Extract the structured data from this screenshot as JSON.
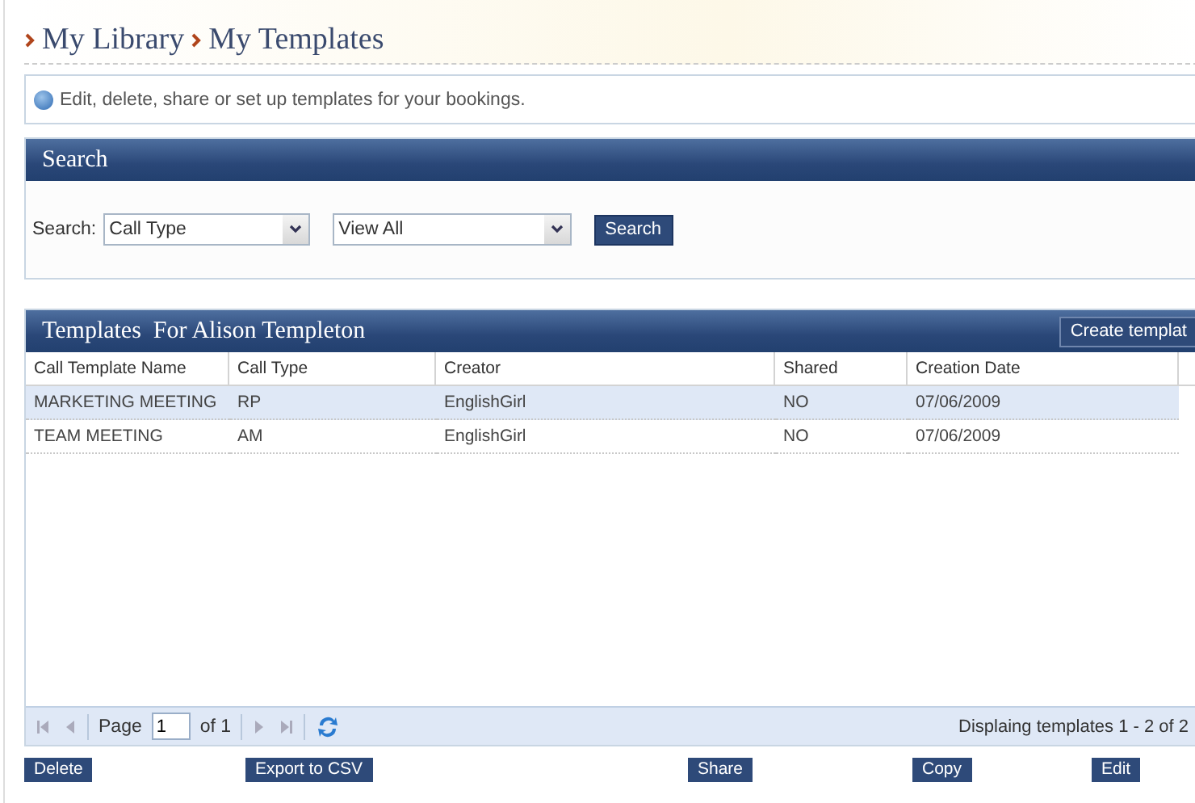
{
  "breadcrumb": [
    {
      "label": "My Library"
    },
    {
      "label": "My Templates"
    }
  ],
  "info": "Edit, delete, share or set up templates for your bookings.",
  "search": {
    "title": "Search",
    "label": "Search:",
    "field": "Call Type",
    "filter": "View All",
    "button": "Search"
  },
  "templates": {
    "title": "Templates  For Alison Templeton",
    "create_button": "Create templat",
    "columns": [
      "Call Template Name",
      "Call Type",
      "Creator",
      "Shared",
      "Creation Date"
    ],
    "rows": [
      {
        "cells": [
          "MARKETING MEETING",
          "RP",
          "EnglishGirl",
          "NO",
          "07/06/2009"
        ],
        "selected": true
      },
      {
        "cells": [
          "TEAM MEETING",
          "AM",
          "EnglishGirl",
          "NO",
          "07/06/2009"
        ],
        "selected": false
      }
    ],
    "pager": {
      "page_label": "Page",
      "page": "1",
      "of": "of 1",
      "status": "Displaing templates 1 - 2 of 2"
    }
  },
  "actions": [
    "Delete",
    "Export to CSV",
    "Share",
    "Copy",
    "Edit"
  ]
}
